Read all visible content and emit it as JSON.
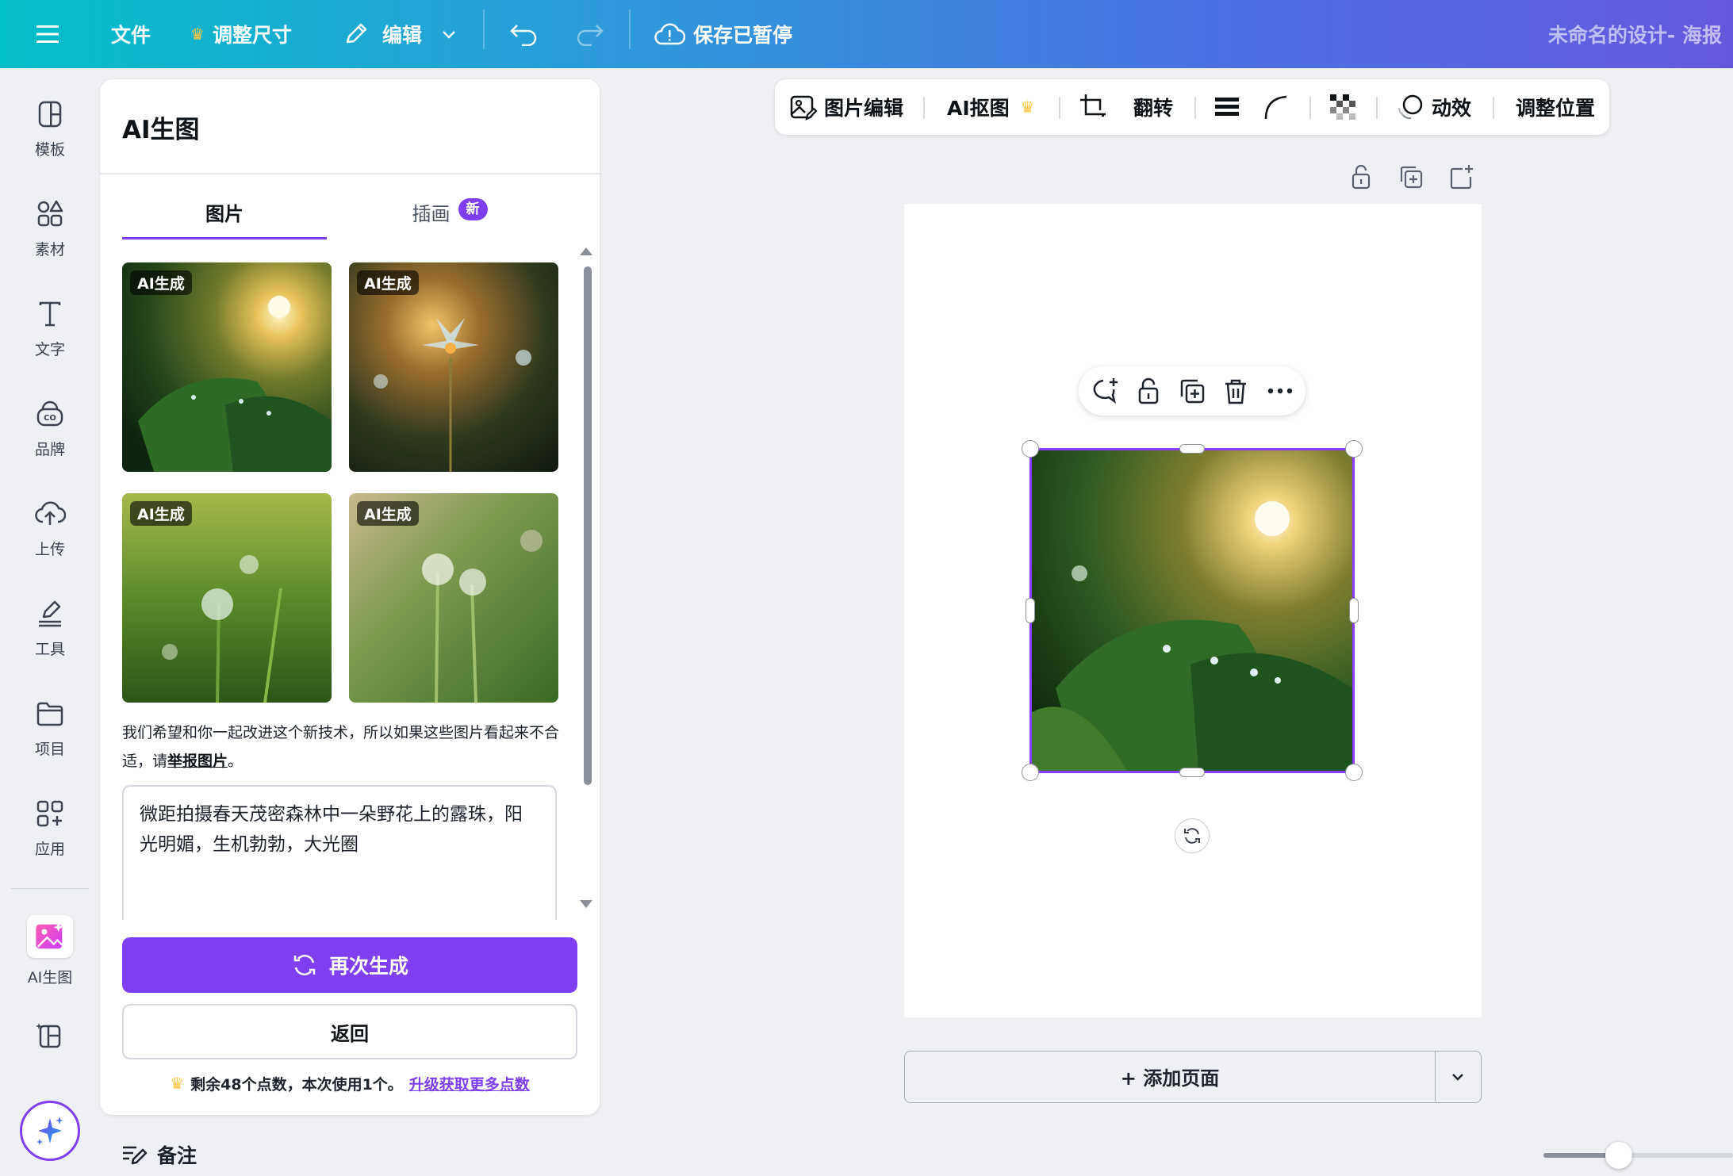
{
  "topbar": {
    "file_label": "文件",
    "resize_label": "调整尺寸",
    "edit_label": "编辑",
    "save_status": "保存已暂停",
    "doc_title": "未命名的设计- 海报"
  },
  "rail": {
    "items": [
      {
        "label": "模板",
        "icon": "template-icon"
      },
      {
        "label": "素材",
        "icon": "elements-icon"
      },
      {
        "label": "文字",
        "icon": "text-icon"
      },
      {
        "label": "品牌",
        "icon": "brand-icon"
      },
      {
        "label": "上传",
        "icon": "upload-icon"
      },
      {
        "label": "工具",
        "icon": "tools-icon"
      },
      {
        "label": "项目",
        "icon": "folder-icon"
      },
      {
        "label": "应用",
        "icon": "apps-icon"
      },
      {
        "label": "AI生图",
        "icon": "ai-image-icon"
      }
    ]
  },
  "panel": {
    "title": "AI生图",
    "tabs": [
      {
        "label": "图片",
        "active": true
      },
      {
        "label": "插画",
        "badge": "新"
      }
    ],
    "images": [
      {
        "tag": "AI生成"
      },
      {
        "tag": "AI生成"
      },
      {
        "tag": "AI生成"
      },
      {
        "tag": "AI生成"
      }
    ],
    "disclaimer_text": "我们希望和你一起改进这个新技术，所以如果这些图片看起来不合适，请",
    "disclaimer_link": "举报图片",
    "disclaimer_end": "。",
    "prompt": "微距拍摄春天茂密森林中一朵野花上的露珠，阳光明媚，生机勃勃，大光圈",
    "regenerate_label": "再次生成",
    "back_label": "返回",
    "credits_text": "剩余48个点数，本次使用1个。",
    "credits_link": "升级获取更多点数"
  },
  "notes_label": "备注",
  "edit_toolbar": {
    "image_edit": "图片编辑",
    "ai_cutout": "AI抠图",
    "flip": "翻转",
    "animate": "动效",
    "position": "调整位置"
  },
  "canvas": {
    "add_page_label": "+ 添加页面"
  },
  "colors": {
    "accent": "#7d3ff0",
    "selection": "#8b3dff"
  }
}
